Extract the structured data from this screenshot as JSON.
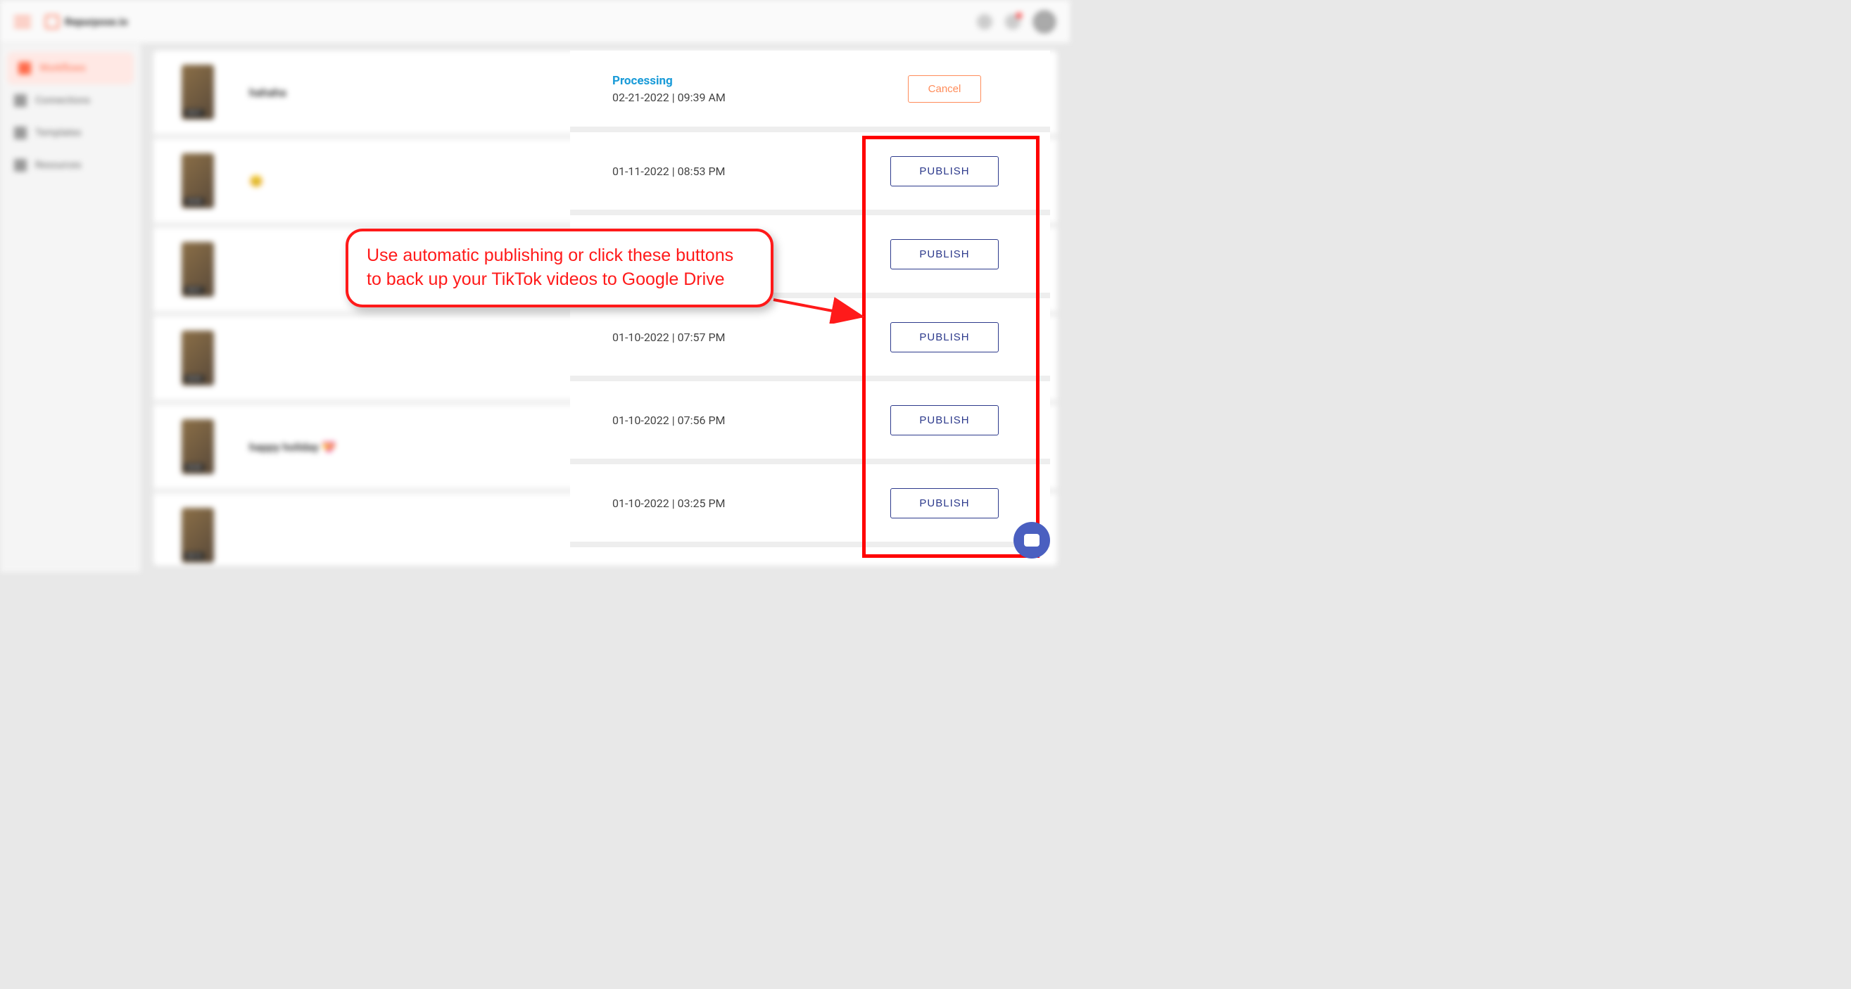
{
  "header": {
    "logo_text": "Repurpose.io"
  },
  "sidebar": {
    "items": [
      {
        "label": "Workflows",
        "active": true
      },
      {
        "label": "Connections",
        "active": false
      },
      {
        "label": "Templates",
        "active": false
      },
      {
        "label": "Resources",
        "active": false
      }
    ]
  },
  "rows": [
    {
      "title": "hahaha",
      "duration": "00:07",
      "status": "Processing",
      "datetime": "02-21-2022 | 09:39 AM",
      "action_label": "Cancel",
      "action_type": "cancel",
      "height": 116
    },
    {
      "title": "😊",
      "duration": "00:08",
      "status": "",
      "datetime": "01-11-2022 | 08:53 PM",
      "action_label": "PUBLISH",
      "action_type": "publish",
      "height": 118
    },
    {
      "title": "",
      "duration": "00:07",
      "status": "",
      "datetime": "",
      "action_label": "PUBLISH",
      "action_type": "publish",
      "height": 118
    },
    {
      "title": "",
      "duration": "00:09",
      "status": "",
      "datetime": "01-10-2022 | 07:57 PM",
      "action_label": "PUBLISH",
      "action_type": "publish",
      "height": 118
    },
    {
      "title": "happy holiday 💝",
      "duration": "00:08",
      "status": "",
      "datetime": "01-10-2022 | 07:56 PM",
      "action_label": "PUBLISH",
      "action_type": "publish",
      "height": 118
    },
    {
      "title": "",
      "duration": "00:16",
      "status": "",
      "datetime": "01-10-2022 | 03:25 PM",
      "action_label": "PUBLISH",
      "action_type": "publish",
      "height": 118
    }
  ],
  "annotation": {
    "callout_text": "Use automatic publishing or click these buttons to back up your TikTok videos to Google Drive"
  },
  "colors": {
    "accent": "#ff6b4a",
    "publish": "#2d3a8c",
    "processing": "#1a9bd8",
    "highlight": "#ff0000"
  }
}
